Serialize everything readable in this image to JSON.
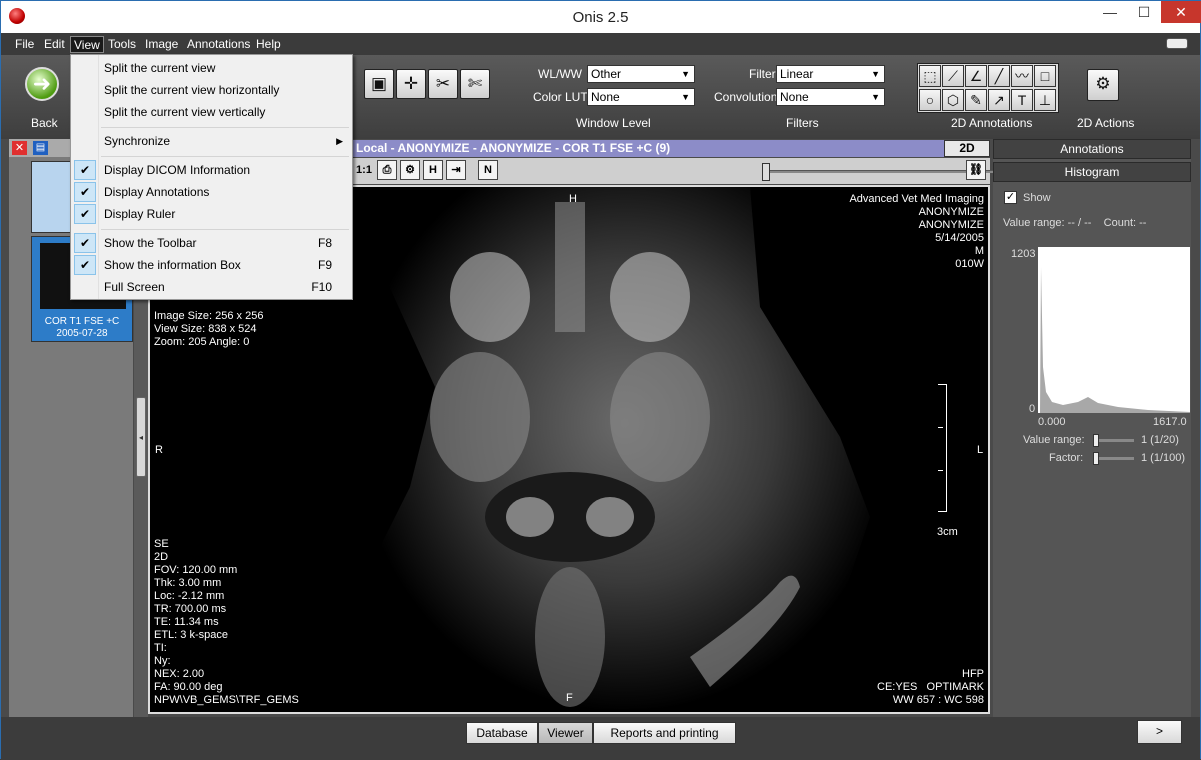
{
  "window": {
    "title": "Onis 2.5",
    "min": "—",
    "max": "☐",
    "close": "✕"
  },
  "menu": [
    "File",
    "Edit",
    "View",
    "Tools",
    "Image",
    "Annotations",
    "Help"
  ],
  "toolbar": {
    "back_label": "Back",
    "wlww_label": "WL/WW",
    "wlww_value": "Other",
    "lut_label": "Color LUT",
    "lut_value": "None",
    "filter_label": "Filter",
    "filter_value": "Linear",
    "conv_label": "Convolution",
    "conv_value": "None",
    "sections": {
      "window_level": "Window Level",
      "filters": "Filters",
      "annotations": "2D Annotations",
      "actions": "2D Actions"
    }
  },
  "view_menu": {
    "items": [
      {
        "label": "Split the current view",
        "checked": false,
        "shortcut": ""
      },
      {
        "label": "Split the current view horizontally",
        "checked": false,
        "shortcut": ""
      },
      {
        "label": "Split the current view vertically",
        "checked": false,
        "shortcut": ""
      },
      {
        "label": "Synchronize",
        "checked": false,
        "shortcut": ""
      },
      {
        "label": "Display DICOM Information",
        "checked": true,
        "shortcut": ""
      },
      {
        "label": "Display Annotations",
        "checked": true,
        "shortcut": ""
      },
      {
        "label": "Display Ruler",
        "checked": true,
        "shortcut": ""
      },
      {
        "label": "Show the Toolbar",
        "checked": true,
        "shortcut": "F8"
      },
      {
        "label": "Show the information Box",
        "checked": true,
        "shortcut": "F9"
      },
      {
        "label": "Full Screen",
        "checked": false,
        "shortcut": "F10"
      }
    ]
  },
  "series": [
    {
      "line1": "COR T1 FSE +C",
      "line2": "2005-07-28"
    }
  ],
  "viewer_header": "Local - ANONYMIZE - ANONYMIZE - COR T1 FSE +C (9)",
  "view_mode": "2D",
  "viewtb": {
    "ratio": "1:1"
  },
  "overlay": {
    "top_right": "Advanced Vet Med Imaging\nANONYMIZE\nANONYMIZE\n5/14/2005\nM\n010W",
    "top_left": "Image Size: 256 x 256\nView Size: 838 x 524\nZoom: 205 Angle: 0",
    "bottom_left": "SE\n2D\nFOV: 120.00 mm\nThk: 3.00 mm\nLoc: -2.12 mm\nTR: 700.00 ms\nTE: 11.34 ms\nETL: 3 k-space\nTI:\nNy:\nNEX: 2.00\nFA: 90.00 deg\nNPW\\VB_GEMS\\TRF_GEMS",
    "bottom_right": "HFP\nCE:YES   OPTIMARK\nWW 657 : WC 598",
    "orient_top": "H",
    "orient_bottom": "F",
    "orient_left": "R",
    "orient_right": "L",
    "ruler": "3cm"
  },
  "right": {
    "annotations_btn": "Annotations",
    "histogram_btn": "Histogram",
    "show_label": "Show",
    "value_range": "Value range: -- / --    Count: --",
    "hist_max": "1203",
    "hist_min": "0",
    "hist_x0": "0.000",
    "hist_x1": "1617.0",
    "vr_label": "Value range:",
    "vr_value": "1 (1/20)",
    "factor_label": "Factor:",
    "factor_value": "1 (1/100)"
  },
  "bottom": {
    "database": "Database",
    "viewer": "Viewer",
    "reports": "Reports and printing",
    "next": ">"
  },
  "colors": {
    "header_purple": "#8c8cc8",
    "thumb_blue": "#2d7cc8",
    "check_bg": "#cde6f7"
  }
}
